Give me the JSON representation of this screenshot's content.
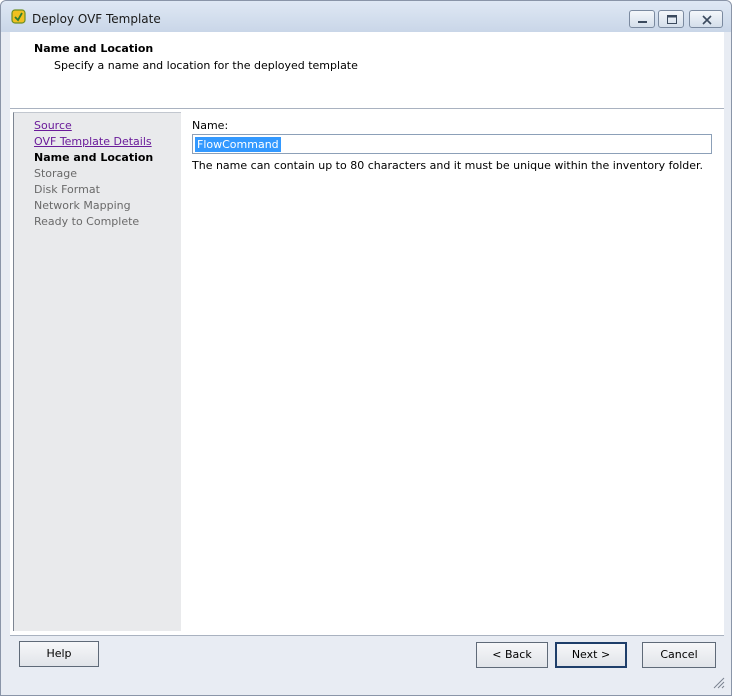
{
  "window": {
    "title": "Deploy OVF Template",
    "controls": {
      "minimize_icon": "minimize-icon",
      "maximize_icon": "maximize-icon",
      "close_icon": "close-icon"
    }
  },
  "header": {
    "title": "Name and Location",
    "subtitle": "Specify a name and location for the deployed template"
  },
  "nav": {
    "items": [
      {
        "label": "Source",
        "state": "link"
      },
      {
        "label": "OVF Template Details",
        "state": "link"
      },
      {
        "label": "Name and Location",
        "state": "current"
      },
      {
        "label": "Storage",
        "state": "disabled"
      },
      {
        "label": "Disk Format",
        "state": "disabled"
      },
      {
        "label": "Network Mapping",
        "state": "disabled"
      },
      {
        "label": "Ready to Complete",
        "state": "disabled"
      }
    ]
  },
  "form": {
    "name_label": "Name:",
    "name_value": "FlowCommand",
    "name_help": "The name can contain up to 80 characters and it must be unique within the inventory folder."
  },
  "footer": {
    "help_label": "Help",
    "back_label": "< Back",
    "next_label": "Next >",
    "cancel_label": "Cancel"
  },
  "colors": {
    "link": "#6a1b9a",
    "selection": "#3399ff",
    "window_frame": "#e8ecf3"
  }
}
